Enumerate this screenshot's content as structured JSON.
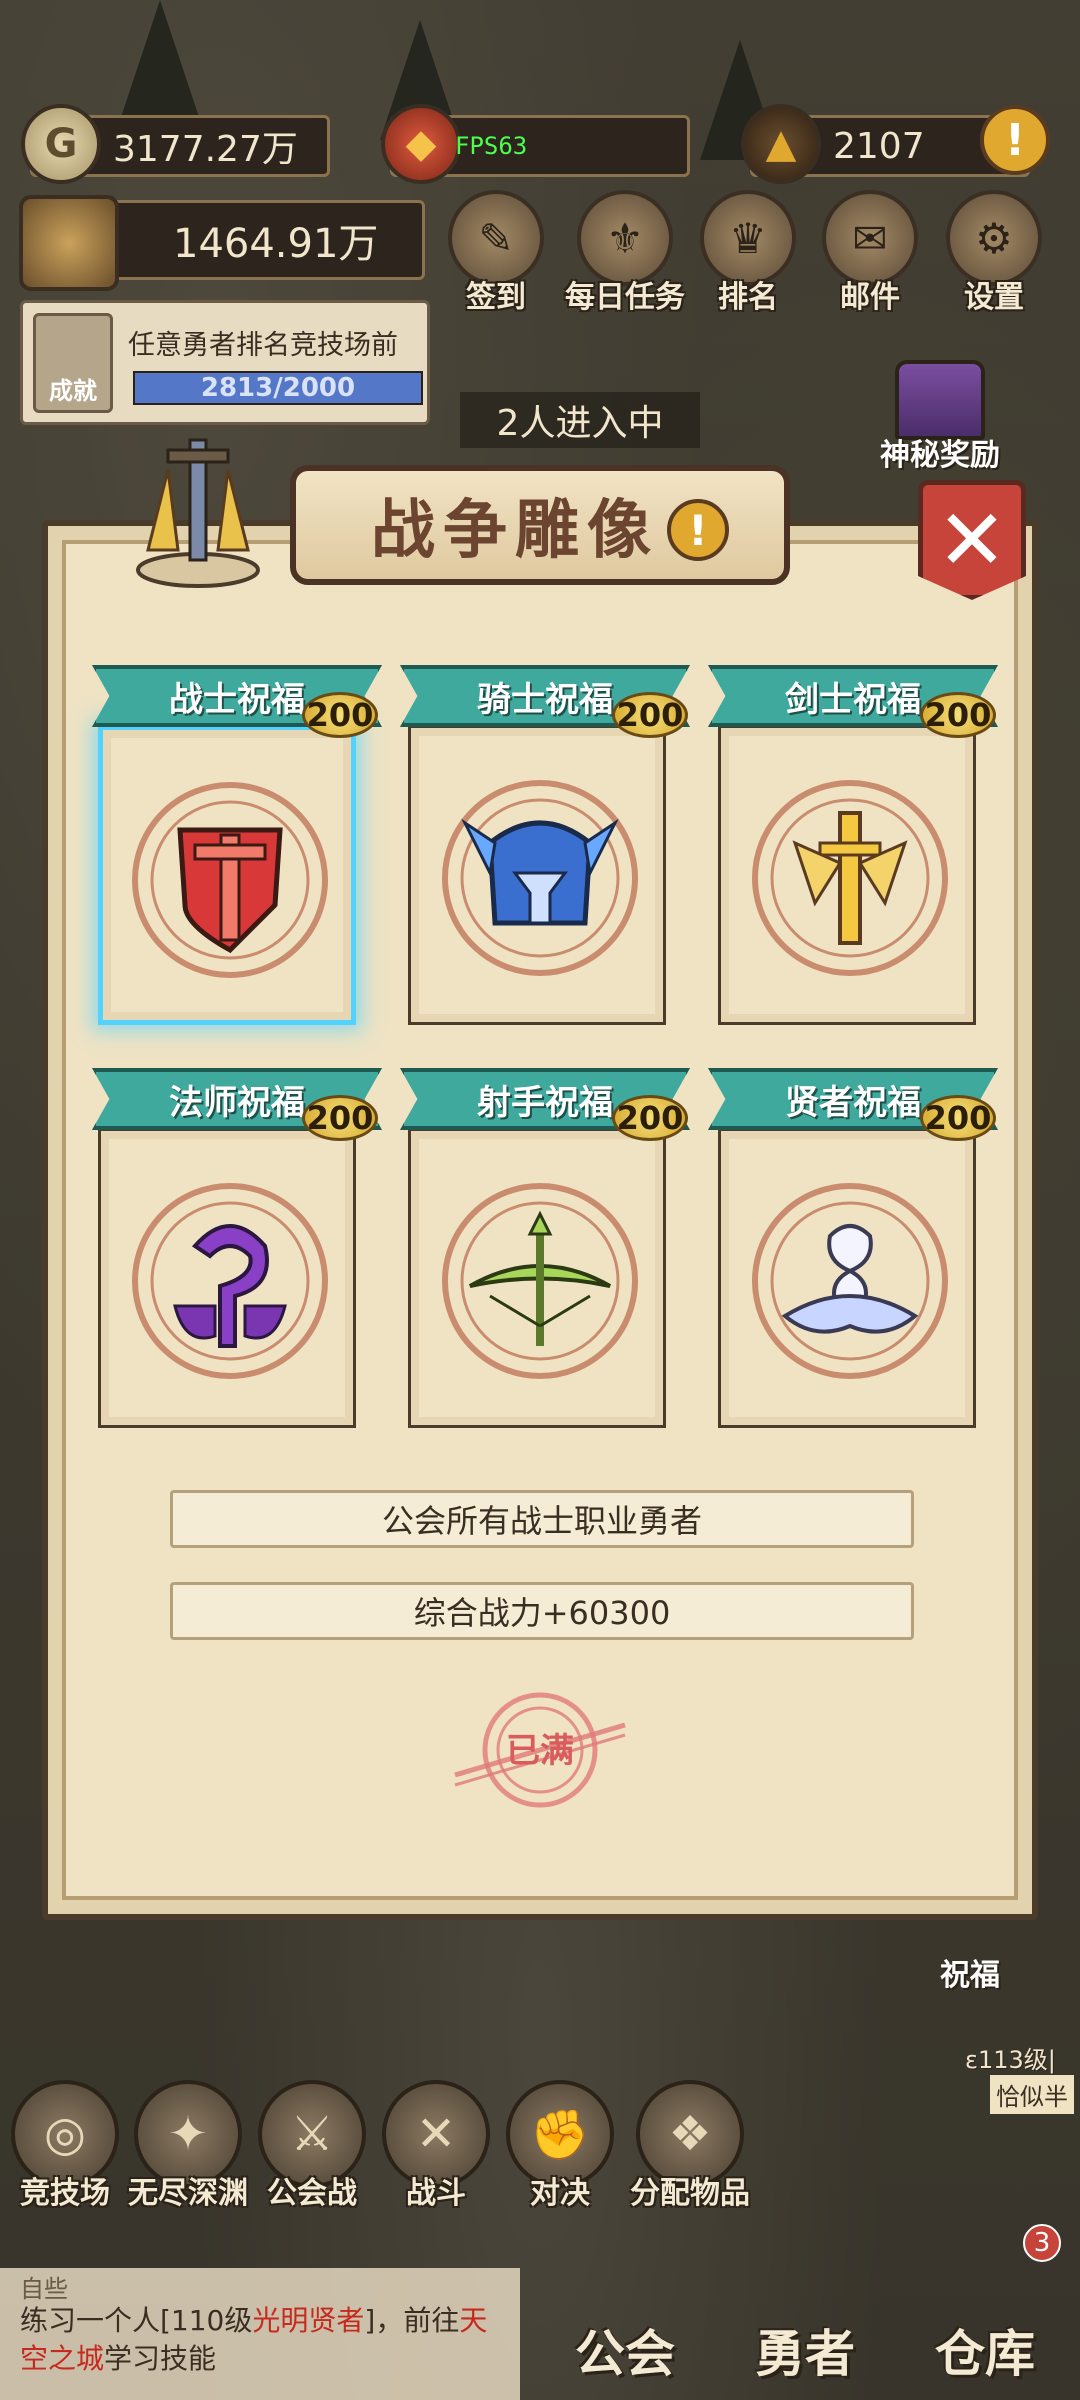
{
  "hud": {
    "gold": "3177.27万",
    "fps": "FPS63",
    "diamonds": "2107",
    "combat_power": "1464.91万"
  },
  "quick_menu": [
    {
      "label": "签到",
      "icon": "sign-in-icon"
    },
    {
      "label": "每日任务",
      "icon": "daily-task-icon"
    },
    {
      "label": "排名",
      "icon": "ranking-icon"
    },
    {
      "label": "邮件",
      "icon": "mail-icon"
    },
    {
      "label": "设置",
      "icon": "gear-icon"
    }
  ],
  "achievement": {
    "label": "成就",
    "task": "任意勇者排名竞技场前",
    "progress_text": "2813/2000",
    "progress_ratio": 1.0
  },
  "entering_text": "2人进入中",
  "secret_reward": "神秘奖励",
  "modal": {
    "title": "战争雕像",
    "warning": "!",
    "close": "✕"
  },
  "blessings": [
    {
      "name": "战士祝福",
      "level": "200",
      "icon": "warrior-shield-icon",
      "selected": true
    },
    {
      "name": "骑士祝福",
      "level": "200",
      "icon": "knight-helmet-icon",
      "selected": false
    },
    {
      "name": "剑士祝福",
      "level": "200",
      "icon": "sword-icon",
      "selected": false
    },
    {
      "name": "法师祝福",
      "level": "200",
      "icon": "mage-flame-icon",
      "selected": false
    },
    {
      "name": "射手祝福",
      "level": "200",
      "icon": "crossbow-icon",
      "selected": false
    },
    {
      "name": "贤者祝福",
      "level": "200",
      "icon": "sage-spirit-icon",
      "selected": false
    }
  ],
  "info": {
    "target": "公会所有战士职业勇者",
    "bonus": "综合战力+60300",
    "stamp": "已满"
  },
  "dock": [
    {
      "label": "竞技场",
      "icon": "arena-target-icon"
    },
    {
      "label": "无尽深渊",
      "icon": "abyss-icon"
    },
    {
      "label": "公会战",
      "icon": "guild-war-icon"
    },
    {
      "label": "战斗",
      "icon": "battle-swords-icon"
    },
    {
      "label": "对决",
      "icon": "fist-icon"
    },
    {
      "label": "分配物品",
      "icon": "distribute-icon"
    }
  ],
  "right_side": {
    "blessing": "祝福",
    "level_text": "ε113级|",
    "hint": "恰似半"
  },
  "chat": {
    "channel": "自些",
    "line1_prefix": "练习一个人[110级",
    "line1_red": "光明贤者",
    "line1_suffix": "]，前往",
    "line1_red2": "天",
    "line2_red": "空之城",
    "line2_suffix": "学习技能"
  },
  "nav": {
    "guild": "公会",
    "hero": "勇者",
    "warehouse": "仓库",
    "badge": "3"
  },
  "colors": {
    "ribbon": "#3fa99d",
    "selected_glow": "#54d2ff",
    "close_red": "#c7443a",
    "panel": "#efe3c4"
  }
}
